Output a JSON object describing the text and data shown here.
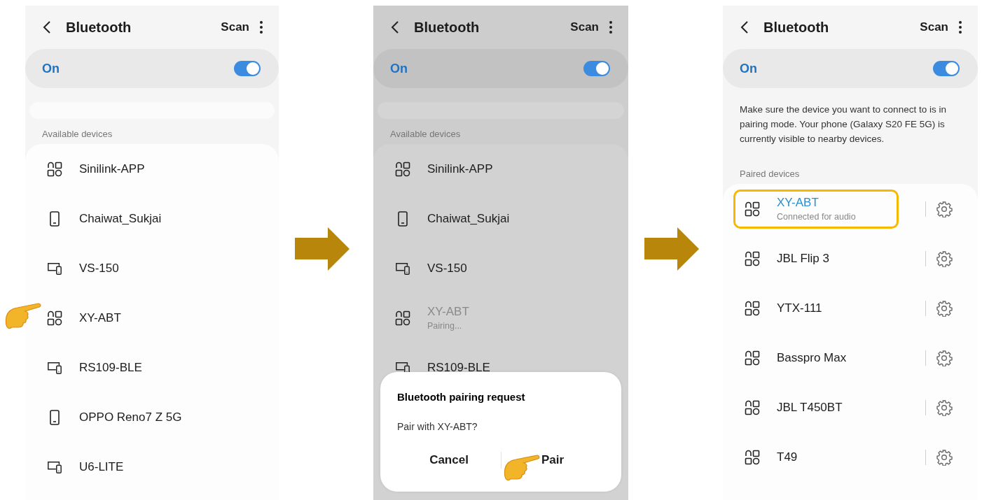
{
  "steps": [
    {
      "kind": "available",
      "dimmed": false,
      "title": "Bluetooth",
      "scan": "Scan",
      "toggle": {
        "label": "On",
        "on": true
      },
      "section": "Available devices",
      "devices": [
        {
          "kind": "grid",
          "name": "Sinilink-APP",
          "pointed": false
        },
        {
          "kind": "phone",
          "name": "Chaiwat_Sukjai",
          "pointed": false
        },
        {
          "kind": "screens",
          "name": "VS-150",
          "pointed": false
        },
        {
          "kind": "grid",
          "name": "XY-ABT",
          "pointed": true
        },
        {
          "kind": "screens",
          "name": "RS109-BLE",
          "pointed": false
        },
        {
          "kind": "phone",
          "name": "OPPO Reno7 Z 5G",
          "pointed": false
        },
        {
          "kind": "screens",
          "name": "U6-LITE",
          "pointed": false
        }
      ]
    },
    {
      "kind": "available",
      "dimmed": true,
      "title": "Bluetooth",
      "scan": "Scan",
      "toggle": {
        "label": "On",
        "on": true
      },
      "section": "Available devices",
      "devices": [
        {
          "kind": "grid",
          "name": "Sinilink-APP",
          "connecting": false
        },
        {
          "kind": "phone",
          "name": "Chaiwat_Sukjai",
          "connecting": false
        },
        {
          "kind": "screens",
          "name": "VS-150",
          "connecting": false
        },
        {
          "kind": "grid",
          "name": "XY-ABT",
          "status": "Pairing...",
          "connecting": true
        },
        {
          "kind": "screens",
          "name": "RS109-BLE",
          "connecting": false
        }
      ],
      "dialog": {
        "title": "Bluetooth pairing request",
        "message": "Pair with XY-ABT?",
        "buttons": [
          {
            "label": "Cancel",
            "pointed": false
          },
          {
            "label": "Pair",
            "pointed": true
          }
        ]
      }
    },
    {
      "kind": "paired",
      "dimmed": false,
      "title": "Bluetooth",
      "scan": "Scan",
      "toggle": {
        "label": "On",
        "on": true
      },
      "info": "Make sure the device you want to connect to is in pairing mode. Your phone (Galaxy S20 FE 5G) is currently visible to nearby devices.",
      "section": "Paired devices",
      "devices": [
        {
          "kind": "grid",
          "name": "XY-ABT",
          "status": "Connected for audio",
          "connected": true,
          "highlighted": true
        },
        {
          "kind": "grid",
          "name": "JBL Flip 3",
          "connected": false,
          "highlighted": false
        },
        {
          "kind": "grid",
          "name": "YTX-111",
          "connected": false,
          "highlighted": false
        },
        {
          "kind": "grid",
          "name": "Basspro Max",
          "connected": false,
          "highlighted": false
        },
        {
          "kind": "grid",
          "name": "JBL T450BT",
          "connected": false,
          "highlighted": false
        },
        {
          "kind": "grid",
          "name": "T49",
          "connected": false,
          "highlighted": false
        }
      ]
    }
  ]
}
